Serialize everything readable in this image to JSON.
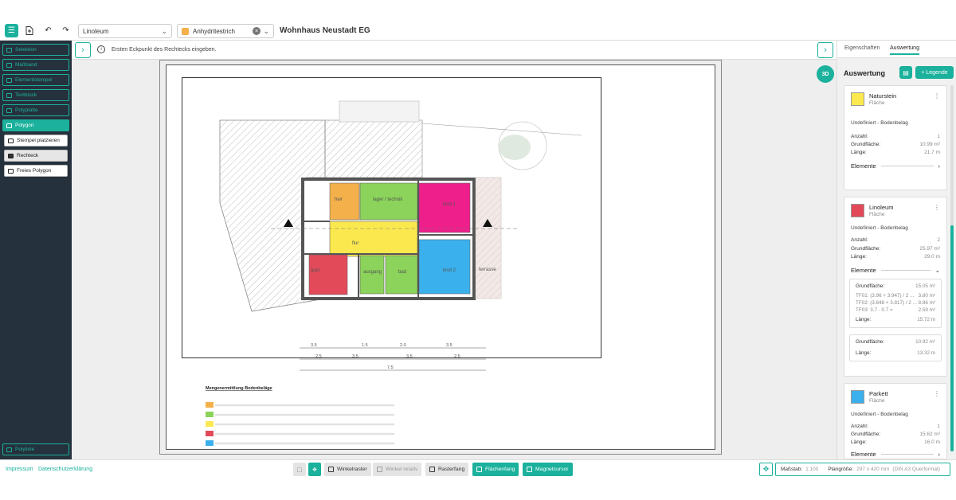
{
  "topbar": {
    "material_select": "Linoleum",
    "screed_select": "Anhydritestrich",
    "screed_color": "#f4b04b",
    "project_title": "Wohnhaus Neustadt EG",
    "icons": [
      "menu-icon",
      "add-file-icon",
      "undo-icon",
      "redo-icon"
    ]
  },
  "panel_tabs": {
    "properties": "Eigenschaften",
    "evaluation": "Auswertung"
  },
  "sidebar": {
    "items": [
      {
        "label": "Selektion"
      },
      {
        "label": "Maßband"
      },
      {
        "label": "Elementstempel"
      },
      {
        "label": "Textblock"
      },
      {
        "label": "Polyplatte"
      },
      {
        "label": "Polygon"
      },
      {
        "label": "Stempel platzieren"
      },
      {
        "label": "Rechteck"
      },
      {
        "label": "Freies Polygon"
      }
    ],
    "bottom_item": "Polylinie"
  },
  "infobar": {
    "message": "Ersten Eckpunkt des Rechtecks eingeben."
  },
  "view_3d": "3D",
  "plan": {
    "rooms": [
      {
        "name": "hwr",
        "color": "#f4b04b"
      },
      {
        "name": "lager / technik",
        "color": "#8bd35a"
      },
      {
        "name": "kind 1",
        "color": "#ee1f8a"
      },
      {
        "name": "flur",
        "color": "#fbe84e"
      },
      {
        "name": "gast",
        "color": "#e24a5a"
      },
      {
        "name": "ausgang",
        "color": "#8bd35a"
      },
      {
        "name": "bad",
        "color": "#8bd35a"
      },
      {
        "name": "kind 2",
        "color": "#3ab0ec"
      },
      {
        "name": "terrasse",
        "color": "#e9dbd6"
      }
    ],
    "legend_title": "Mengenermittlung Bodenbeläge",
    "dims_top": [
      "3.5",
      "1.5",
      "2.0",
      "3.5"
    ],
    "dims_mid": [
      "2.5",
      "3.5",
      "3.5",
      "2.5"
    ],
    "dims_bottom": "7.5"
  },
  "panel": {
    "title": "Auswertung",
    "legend_button": "+ Legende",
    "cards": [
      {
        "name": "Naturstein",
        "type": "Fläche",
        "color": "#fbe84e",
        "desc": "Undefiniert - Bodenbelag",
        "rows": [
          [
            "Anzahl:",
            "1"
          ],
          [
            "Grundfläche:",
            "10.99 m²"
          ],
          [
            "Länge:",
            "21.7 m"
          ]
        ],
        "elements": "Elemente"
      },
      {
        "name": "Linoleum",
        "type": "Fläche",
        "color": "#e24a5a",
        "desc": "Undefiniert - Bodenbelag",
        "rows": [
          [
            "Anzahl:",
            "2"
          ],
          [
            "Grundfläche:",
            "25.97 m²"
          ],
          [
            "Länge:",
            "29.0 m"
          ]
        ],
        "elements": "Elemente",
        "sub1": {
          "head": [
            "Grundfläche:",
            "15.05 m²"
          ],
          "lines": [
            [
              "TF01: (3.96 + 3.947) / 2 ...",
              "3.80 m²"
            ],
            [
              "TF02: (3.848 + 3.817) / 2 ...",
              "8.86 m²"
            ],
            [
              "TF03: 3.7 · 0.7 =",
              "2.59 m²"
            ]
          ],
          "length": [
            "Länge:",
            "15.72 m"
          ]
        },
        "sub2": {
          "head": [
            "Grundfläche:",
            "10.92 m²"
          ],
          "length": [
            "Länge:",
            "13.32 m"
          ]
        }
      },
      {
        "name": "Parkett",
        "type": "Fläche",
        "color": "#3ab0ec",
        "desc": "Undefiniert - Bodenbelag",
        "rows": [
          [
            "Anzahl:",
            "1"
          ],
          [
            "Grundfläche:",
            "15.62 m²"
          ],
          [
            "Länge:",
            "16.0 m"
          ]
        ],
        "elements": "Elemente"
      }
    ]
  },
  "bottombar": {
    "imprint": "Impressum",
    "privacy": "Datenschutzerklärung",
    "buttons": {
      "angle_grid": "Winkelraster",
      "angle_relative": "Winkel relativ",
      "grid_snap": "Rasterfang",
      "area_snap": "Flächenfang",
      "magnet_cursor": "Magnetcursor"
    },
    "scale_label": "Maßstab:",
    "scale_value": "1:100",
    "plan_size_label": "Plangröße:",
    "plan_size_value": "297 x 420 mm",
    "plan_format": "(DIN A3 Querformat)"
  }
}
